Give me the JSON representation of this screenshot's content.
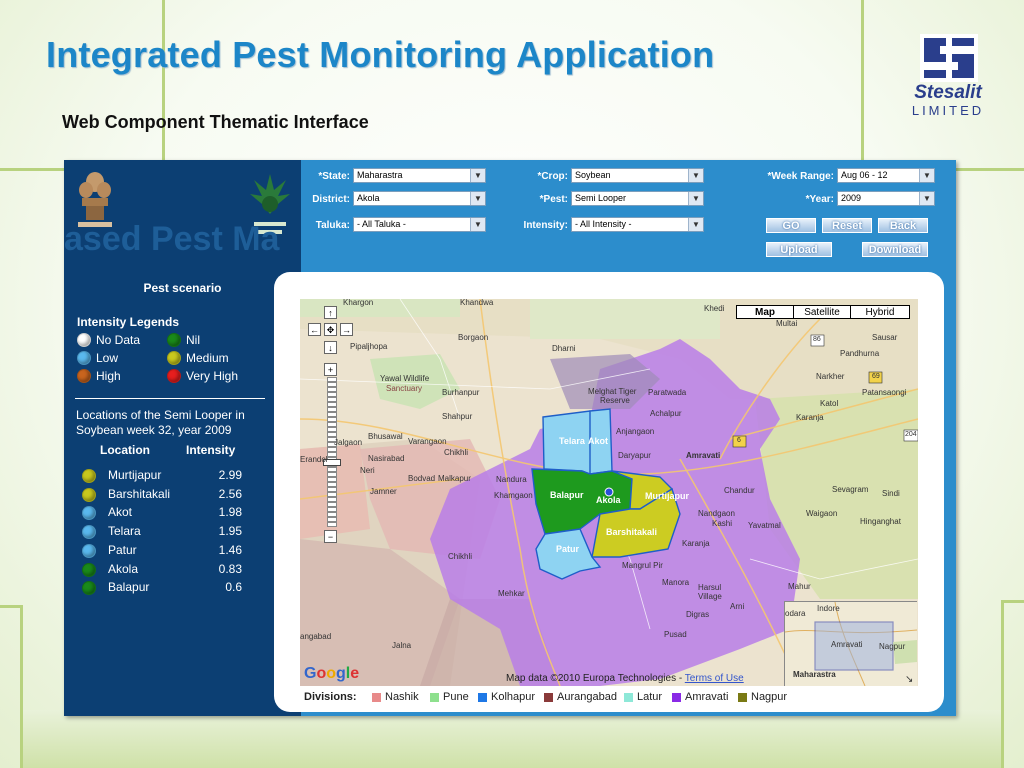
{
  "slide": {
    "title": "Integrated Pest Monitoring  Application",
    "subtitle": "Web Component Thematic Interface",
    "logo_name": "Stesalit",
    "logo_sub": "LIMITED"
  },
  "left_panel": {
    "watermark": "ased Pest Ma",
    "pest_scenario": "Pest scenario",
    "legend_title": "Intensity Legends",
    "legends": [
      {
        "label": "No Data",
        "color": "#ffffff"
      },
      {
        "label": "Nil",
        "color": "#1a8a1a"
      },
      {
        "label": "Low",
        "color": "#5ab8ee"
      },
      {
        "label": "Medium",
        "color": "#c8c81e"
      },
      {
        "label": "High",
        "color": "#c8641e"
      },
      {
        "label": "Very High",
        "color": "#e61e1e"
      }
    ],
    "locations_title": "Locations of the Semi Looper in Soybean week 32, year 2009",
    "col_location": "Location",
    "col_intensity": "Intensity",
    "locations": [
      {
        "name": "Murtijapur",
        "value": "2.99",
        "color": "#c8c81e"
      },
      {
        "name": "Barshitakali",
        "value": "2.56",
        "color": "#c8c81e"
      },
      {
        "name": "Akot",
        "value": "1.98",
        "color": "#5ab8ee"
      },
      {
        "name": "Telara",
        "value": "1.95",
        "color": "#5ab8ee"
      },
      {
        "name": "Patur",
        "value": "1.46",
        "color": "#5ab8ee"
      },
      {
        "name": "Akola",
        "value": "0.83",
        "color": "#1a8a1a"
      },
      {
        "name": "Balapur",
        "value": "0.6",
        "color": "#1a8a1a"
      }
    ]
  },
  "form": {
    "state_label": "*State:",
    "state_value": "Maharastra",
    "district_label": "District:",
    "district_value": "Akola",
    "taluka_label": "Taluka:",
    "taluka_value": "- All Taluka -",
    "crop_label": "*Crop:",
    "crop_value": "Soybean",
    "pest_label": "*Pest:",
    "pest_value": "Semi Looper",
    "intensity_label": "Intensity:",
    "intensity_value": "- All Intensity -",
    "week_label": "*Week Range:",
    "week_value": "Aug 06 - 12",
    "year_label": "*Year:",
    "year_value": "2009",
    "go": "GO",
    "reset": "Reset",
    "back": "Back",
    "upload": "Upload",
    "download": "Download"
  },
  "map": {
    "type_map": "Map",
    "type_satellite": "Satellite",
    "type_hybrid": "Hybrid",
    "copyright": "Map data ©2010 Europa Technologies - ",
    "terms": "Terms of Use",
    "google": "Google",
    "districts": {
      "telara": "Telara",
      "akot": "Akot",
      "balapur": "Balapur",
      "akola": "Akola",
      "murtijapur": "Murtijapur",
      "barshitakali": "Barshitakali",
      "patur": "Patur"
    },
    "places": {
      "khargon": "Khargon",
      "khandwa": "Khandwa",
      "khedi": "Khedi",
      "multai": "Multai",
      "sausar": "Sausar",
      "pandhurna": "Pandhurna",
      "narkher": "Narkher",
      "katol": "Katol",
      "karanja": "Karanja",
      "patansaongi": "Patansaongi",
      "borgaon": "Borgaon",
      "pipaljhopa": "Pipaljhopa",
      "dharni": "Dharni",
      "yawal": "Yawal Wildlife",
      "sanctuary": "Sanctuary",
      "burhanpur": "Burhanpur",
      "melghat": "Melghat Tiger",
      "reserve": "Reserve",
      "paratwada": "Paratwada",
      "achalpur": "Achalpur",
      "anjangaon": "Anjangaon",
      "shahpur": "Shahpur",
      "bhusawal": "Bhusawal",
      "varangaon": "Varangaon",
      "jalgaon": "Jalgaon",
      "chikhli": "Chikhli",
      "nasirabad": "Nasirabad",
      "erandol": "Erandol",
      "dhule": "Dhule",
      "neri": "Neri",
      "bodvad": "Bodvad",
      "malkapur": "Malkapur",
      "nandura": "Nandura",
      "jamner": "Jamner",
      "khamgaon": "Khamgaon",
      "daryapur": "Daryapur",
      "amravati": "Amravati",
      "chandur": "Chandur",
      "sevagram": "Sevagram",
      "sindi": "Sindi",
      "waigaon": "Waigaon",
      "hinganghat": "Hinganghat",
      "nandgaon": "Nandgaon",
      "kashi": "Kashi",
      "karanja2": "Karanja",
      "yavatmal": "Yavatmal",
      "mangrul": "Mangrul Pir",
      "manora": "Manora",
      "harsul": "Harsul",
      "village": "Village",
      "arni": "Arni",
      "digras": "Digras",
      "mehkar": "Mehkar",
      "pusad": "Pusad",
      "jalna": "Jalna",
      "aurangabad": "angabad",
      "chikhli2": "Chikhli",
      "mahur": "Mahur",
      "r86": "86",
      "r69": "69",
      "r6": "6",
      "r204": "204",
      "ov_indore": "Indore",
      "ov_amravati": "Amravati",
      "ov_nagpur": "Nagpur",
      "ov_maharastra": "Maharastra",
      "ov_vadodara": "odara"
    }
  },
  "divisions": {
    "label": "Divisions:",
    "items": [
      {
        "name": "Nashik",
        "color": "#e88a8a"
      },
      {
        "name": "Pune",
        "color": "#8ee08e"
      },
      {
        "name": "Kolhapur",
        "color": "#1e78e6"
      },
      {
        "name": "Aurangabad",
        "color": "#8a3a3a"
      },
      {
        "name": "Latur",
        "color": "#8ee8d8"
      },
      {
        "name": "Amravati",
        "color": "#8a2ae6"
      },
      {
        "name": "Nagpur",
        "color": "#7a7a14"
      }
    ]
  }
}
